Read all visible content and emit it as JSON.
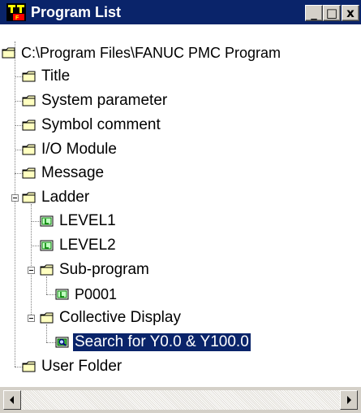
{
  "window": {
    "title": "Program List",
    "icon": "fanuc-app-icon"
  },
  "titlebar_buttons": {
    "minimize": "_",
    "maximize": "□",
    "close": "x"
  },
  "tree": {
    "root": "C:\\Program Files\\FANUC PMC Program",
    "items": {
      "title": "Title",
      "system_parameter": "System parameter",
      "symbol_comment": "Symbol comment",
      "io_module": "I/O Module",
      "message": "Message",
      "ladder": "Ladder",
      "level1": "LEVEL1",
      "level2": "LEVEL2",
      "sub_program": "Sub-program",
      "p0001": "P0001",
      "collective_display": "Collective Display",
      "search": "Search for Y0.0 & Y100.0",
      "user_folder": "User Folder"
    },
    "selected": "search"
  },
  "colors": {
    "titlebar": "#0a246a",
    "selection": "#0a246a",
    "folder": "#ffffc0",
    "ladder_icon": "#008000"
  }
}
